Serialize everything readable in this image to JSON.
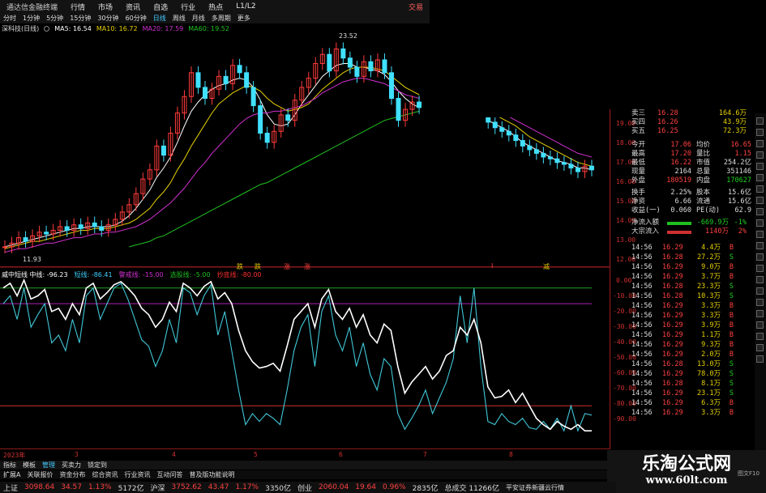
{
  "app": {
    "title": "通达信金融终端",
    "menu": [
      "行情",
      "市场",
      "资讯",
      "自选",
      "行业",
      "热点",
      "L1/L2"
    ],
    "right_label": "交易"
  },
  "toolbar": {
    "items": [
      "分时",
      "1分钟",
      "5分钟",
      "15分钟",
      "30分钟",
      "60分钟",
      "日线",
      "周线",
      "月线",
      "多周期",
      "更多"
    ],
    "active": "日线"
  },
  "stock": {
    "name": "深科技(日线)"
  },
  "ma_legend": [
    {
      "label": "MA5: 16.54",
      "color": "#ffffff"
    },
    {
      "label": "MA10: 16.72",
      "color": "#e6d000"
    },
    {
      "label": "MA20: 17.59",
      "color": "#d030d0"
    },
    {
      "label": "MA60: 19.52",
      "color": "#20c020"
    }
  ],
  "price_annotations": {
    "high": "23.52",
    "low": "11.93"
  },
  "bs_markers": [
    "跌",
    "跌",
    "涨",
    "涨",
    "I",
    "减"
  ],
  "indicator_legend": [
    {
      "label": "威中短线 中线: -96.23",
      "color": "#ffffff"
    },
    {
      "label": "短线: -86.41",
      "color": "#40d0ff"
    },
    {
      "label": "警戒线: -15.00",
      "color": "#d030d0"
    },
    {
      "label": "选股线: -5.00",
      "color": "#20c020"
    },
    {
      "label": "抄底线: -80.00",
      "color": "#ff3030"
    }
  ],
  "x_ticks": [
    "2023年",
    "3",
    "4",
    "5",
    "6",
    "7",
    "8"
  ],
  "price_axis": [
    "19.00",
    "18.00",
    "17.00",
    "16.00",
    "15.00",
    "14.00",
    "13.00",
    "12.00"
  ],
  "indicator_axis": [
    "0.00",
    "-10.00",
    "-20.00",
    "-30.00",
    "-40.00",
    "-50.00",
    "-60.00",
    "-70.00",
    "-80.00",
    "-90.00"
  ],
  "bottom_tabs": [
    "指标",
    "模板",
    "管理",
    "买卖力",
    "锁定到"
  ],
  "info_tabs": [
    "扩展A",
    "关联报价",
    "资金分布",
    "综合资讯",
    "行业资讯",
    "互动问答",
    "普及版功能说明"
  ],
  "quote": {
    "order_book": [
      {
        "label": "卖三",
        "price": "16.28",
        "vol": "164.6万"
      },
      {
        "label": "买四",
        "price": "16.26",
        "vol": "43.9万"
      },
      {
        "label": "买五",
        "price": "16.25",
        "vol": "72.3万"
      }
    ],
    "stats": [
      [
        "今开",
        "17.06",
        "均价",
        "16.65"
      ],
      [
        "最高",
        "17.20",
        "量比",
        "1.15"
      ],
      [
        "最低",
        "16.22",
        "市值",
        "254.2亿"
      ],
      [
        "现量",
        "2164",
        "总量",
        "351146"
      ],
      [
        "外盘",
        "180519",
        "内盘",
        "170627"
      ],
      [
        "换手",
        "2.25%",
        "股本",
        "15.6亿"
      ],
      [
        "净资",
        "6.66",
        "流通",
        "15.6亿"
      ],
      [
        "收益(一)",
        "0.060",
        "PE(动)",
        "62.9"
      ]
    ],
    "flow": [
      {
        "label": "净流入额",
        "value": "-669.9万",
        "pct": "-1%"
      },
      {
        "label": "大宗流入",
        "value": "1140万",
        "pct": "2%"
      }
    ],
    "ticks": [
      [
        "14:56",
        "16.29",
        "4.4万",
        "B"
      ],
      [
        "14:56",
        "16.28",
        "27.2万",
        "S"
      ],
      [
        "14:56",
        "16.29",
        "9.0万",
        "B"
      ],
      [
        "14:56",
        "16.29",
        "3.7万",
        "B"
      ],
      [
        "14:56",
        "16.28",
        "23.3万",
        "S"
      ],
      [
        "14:56",
        "16.28",
        "10.3万",
        "S"
      ],
      [
        "14:56",
        "16.29",
        "3.3万",
        "B"
      ],
      [
        "14:56",
        "16.29",
        "3.3万",
        "B"
      ],
      [
        "14:56",
        "16.29",
        "3.9万",
        "B"
      ],
      [
        "14:56",
        "16.29",
        "1.1万",
        "B"
      ],
      [
        "14:56",
        "16.29",
        "9.3万",
        "B"
      ],
      [
        "14:56",
        "16.29",
        "2.0万",
        "B"
      ],
      [
        "14:56",
        "16.28",
        "13.0万",
        "S"
      ],
      [
        "14:56",
        "16.29",
        "78.0万",
        "S"
      ],
      [
        "14:56",
        "16.28",
        "8.1万",
        "S"
      ],
      [
        "14:56",
        "16.29",
        "23.1万",
        "S"
      ],
      [
        "14:56",
        "16.29",
        "6.3万",
        "B"
      ],
      [
        "14:56",
        "16.29",
        "3.3万",
        "B"
      ]
    ]
  },
  "status_bar": {
    "items": [
      {
        "name": "上证",
        "value": "3098.64",
        "chg": "34.57",
        "pct": "1.13%",
        "amt": "5172亿"
      },
      {
        "name": "沪深",
        "value": "3752.62",
        "chg": "43.47",
        "pct": "1.17%",
        "amt": "3350亿"
      },
      {
        "name": "创业",
        "value": "2060.04",
        "chg": "19.64",
        "pct": "0.96%",
        "amt": "2835亿"
      }
    ],
    "total": "总成交 11266亿",
    "broker": "平安证券新疆云行情"
  },
  "watermark": {
    "line1": "乐淘公式网",
    "line2": "www.60lt.com",
    "corner": "图文F10"
  },
  "chart_data": [
    {
      "type": "candlestick",
      "title": "深科技(日线)",
      "ylim": [
        11.5,
        24
      ],
      "price_min": "11.93",
      "price_max": "23.52",
      "close": [
        12.3,
        12.5,
        12.8,
        12.6,
        12.9,
        13.1,
        13.0,
        13.2,
        13.4,
        13.2,
        13.5,
        13.3,
        13.6,
        13.4,
        13.2,
        13.5,
        13.8,
        14.2,
        14.6,
        15.2,
        16.0,
        16.5,
        17.8,
        17.3,
        18.5,
        19.6,
        20.5,
        21.8,
        21.0,
        20.4,
        20.9,
        21.6,
        21.2,
        22.2,
        21.8,
        21.0,
        20.0,
        18.5,
        18.0,
        18.6,
        19.5,
        19.2,
        20.3,
        21.0,
        21.5,
        22.3,
        22.8,
        21.9,
        23.1,
        22.6,
        22.1,
        21.6,
        22.4,
        21.9,
        22.5,
        21.8,
        20.4,
        19.2,
        19.8,
        20.2,
        19.9,
        null,
        null,
        null,
        null,
        null,
        null,
        null,
        null,
        null,
        19.1,
        18.8,
        18.6,
        18.4,
        18.1,
        17.8,
        17.6,
        17.4,
        17.2,
        17.1,
        16.9,
        16.8,
        16.6,
        16.4,
        16.7,
        16.5
      ],
      "ma_series": [
        {
          "name": "MA5",
          "values": [
            12.3,
            12.4,
            12.5,
            12.6,
            12.7,
            12.8,
            12.9,
            13.0,
            13.1,
            13.2,
            13.3,
            13.3,
            13.4,
            13.4,
            13.4,
            13.4,
            13.5,
            13.7,
            14.0,
            14.4,
            14.9,
            15.4,
            16.1,
            16.6,
            17.2,
            18.0,
            18.9,
            19.7,
            20.2,
            20.6,
            20.9,
            21.1,
            21.2,
            21.4,
            21.5,
            21.4,
            21.0,
            20.3,
            19.5,
            19.0,
            18.9,
            19.0,
            19.5,
            20.1,
            20.6,
            21.1,
            21.6,
            21.9,
            22.2,
            22.3,
            22.3,
            22.1,
            22.1,
            22.0,
            21.9,
            21.7,
            21.3,
            20.8,
            20.4,
            20.1,
            19.9,
            null,
            null,
            null,
            null,
            null,
            null,
            null,
            null,
            null,
            19.2,
            19.0,
            18.8,
            18.6,
            18.3,
            18.0,
            17.8,
            17.6,
            17.4,
            17.2,
            17.0,
            16.9,
            16.8,
            16.6,
            16.6,
            16.5
          ]
        },
        {
          "name": "MA10",
          "values": [
            12.2,
            12.3,
            12.4,
            12.5,
            12.6,
            12.6,
            12.7,
            12.8,
            12.9,
            13.0,
            13.1,
            13.2,
            13.2,
            13.3,
            13.3,
            13.3,
            13.4,
            13.5,
            13.6,
            13.8,
            14.1,
            14.4,
            14.9,
            15.3,
            15.8,
            16.5,
            17.1,
            17.8,
            18.4,
            19.0,
            19.6,
            20.1,
            20.4,
            20.7,
            20.9,
            21.1,
            21.0,
            20.8,
            20.4,
            20.1,
            19.9,
            19.7,
            19.8,
            19.9,
            20.1,
            20.5,
            20.9,
            21.2,
            21.5,
            21.8,
            22.0,
            22.1,
            22.1,
            22.1,
            22.0,
            21.9,
            21.6,
            21.3,
            21.0,
            20.8,
            20.6,
            null,
            null,
            null,
            null,
            null,
            null,
            null,
            null,
            null,
            19.7,
            19.5,
            19.3,
            19.1,
            18.9,
            18.6,
            18.3,
            18.1,
            17.9,
            17.7,
            17.5,
            17.3,
            17.1,
            16.9,
            16.8,
            16.7
          ]
        },
        {
          "name": "MA20",
          "values": [
            12.0,
            12.1,
            12.2,
            12.2,
            12.3,
            12.4,
            12.5,
            12.5,
            12.6,
            12.7,
            12.8,
            12.8,
            12.9,
            13.0,
            13.0,
            13.1,
            13.1,
            13.2,
            13.3,
            13.4,
            13.6,
            13.8,
            14.1,
            14.4,
            14.7,
            15.1,
            15.5,
            16.0,
            16.5,
            16.9,
            17.4,
            17.8,
            18.2,
            18.6,
            19.0,
            19.3,
            19.5,
            19.6,
            19.6,
            19.7,
            19.7,
            19.8,
            19.9,
            20.0,
            20.2,
            20.4,
            20.7,
            20.9,
            21.1,
            21.3,
            21.4,
            21.5,
            21.5,
            21.4,
            21.3,
            21.2,
            21.0,
            20.8,
            20.6,
            20.5,
            20.4,
            null,
            null,
            null,
            null,
            null,
            null,
            null,
            null,
            null,
            20.0,
            19.8,
            19.6,
            19.4,
            19.2,
            19.0,
            18.8,
            18.6,
            18.4,
            18.2,
            18.0,
            17.8,
            17.6,
            17.4,
            17.3,
            17.2
          ]
        },
        {
          "name": "MA60",
          "values": [
            null,
            null,
            null,
            null,
            null,
            null,
            null,
            null,
            null,
            null,
            null,
            null,
            null,
            null,
            null,
            null,
            null,
            null,
            12.3,
            12.4,
            12.5,
            12.6,
            12.8,
            12.9,
            13.1,
            13.3,
            13.5,
            13.7,
            13.9,
            14.1,
            14.3,
            14.5,
            14.7,
            14.9,
            15.1,
            15.3,
            15.5,
            15.7,
            15.8,
            16.0,
            16.2,
            16.4,
            16.6,
            16.8,
            17.0,
            17.2,
            17.4,
            17.6,
            17.8,
            18.0,
            18.2,
            18.4,
            18.6,
            18.8,
            19.0,
            19.2,
            19.3,
            19.4,
            19.5,
            19.6,
            19.7,
            null,
            null,
            null,
            null,
            null,
            null,
            null,
            null,
            null,
            19.9,
            19.9,
            19.8,
            19.8,
            19.7,
            19.7,
            19.6,
            19.6,
            19.6,
            19.5,
            19.5,
            19.5,
            19.5,
            19.5,
            19.5,
            19.5
          ]
        }
      ]
    },
    {
      "type": "line",
      "title": "威中短线",
      "ylim": [
        -100,
        10
      ],
      "series": [
        {
          "name": "中线",
          "values": [
            -5,
            -2,
            -10,
            0,
            -12,
            -10,
            -6,
            -20,
            -18,
            -25,
            -15,
            -22,
            -5,
            -2,
            -12,
            -8,
            -3,
            -1,
            -5,
            -10,
            -18,
            -22,
            -30,
            -25,
            -14,
            -20,
            -2,
            -5,
            -10,
            -4,
            -1,
            -12,
            -8,
            -15,
            -32,
            -45,
            -52,
            -56,
            -55,
            -53,
            -58,
            -42,
            -25,
            -20,
            -15,
            -30,
            -12,
            -6,
            -20,
            -25,
            -18,
            -30,
            -22,
            -35,
            -40,
            -28,
            -32,
            -55,
            -72,
            -65,
            -60,
            -55,
            -63,
            -58,
            -48,
            -45,
            -30,
            -35,
            -25,
            -40,
            -68,
            -75,
            -74,
            -70,
            -78,
            -72,
            -80,
            -88,
            -92,
            -95,
            -90,
            -93,
            -95,
            -92,
            -96,
            -96
          ]
        },
        {
          "name": "短线",
          "values": [
            -15,
            -10,
            -25,
            -5,
            -30,
            -22,
            -15,
            -40,
            -35,
            -45,
            -25,
            -40,
            -10,
            -5,
            -25,
            -15,
            -5,
            -2,
            -12,
            -25,
            -38,
            -42,
            -55,
            -45,
            -25,
            -40,
            -5,
            -8,
            -22,
            -10,
            -3,
            -35,
            -20,
            -45,
            -70,
            -92,
            -85,
            -90,
            -85,
            -88,
            -92,
            -70,
            -45,
            -30,
            -22,
            -55,
            -20,
            -10,
            -35,
            -45,
            -30,
            -55,
            -40,
            -60,
            -70,
            -50,
            -55,
            -85,
            -95,
            -88,
            -80,
            -70,
            -85,
            -75,
            -65,
            -50,
            -10,
            -40,
            -5,
            -55,
            -90,
            -92,
            -85,
            -90,
            -92,
            -88,
            -94,
            -95,
            -90,
            -95,
            -88,
            -96,
            -80,
            -96,
            -85,
            -86
          ]
        }
      ],
      "levels": [
        {
          "name": "警戒线",
          "value": -15
        },
        {
          "name": "选股线",
          "value": -5
        },
        {
          "name": "抄底线",
          "value": -80
        }
      ]
    }
  ]
}
